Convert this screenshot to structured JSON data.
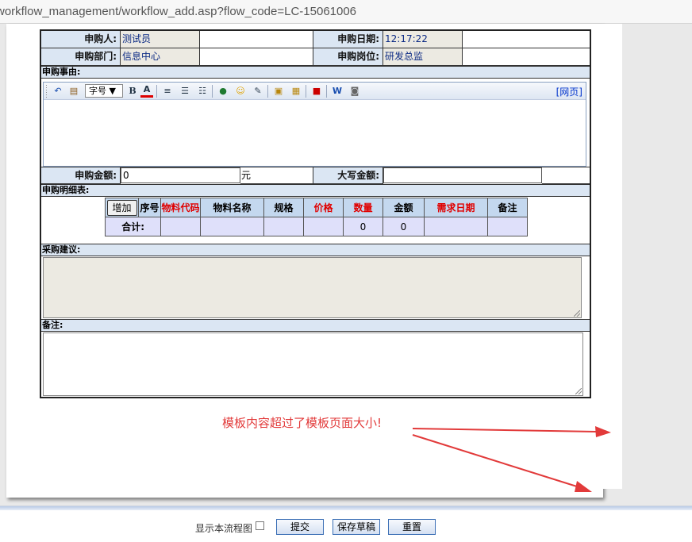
{
  "browser": {
    "url": "workflow_management/workflow_add.asp?flow_code=LC-15061006"
  },
  "form": {
    "applicant_label": "申购人:",
    "applicant_value": "测试员",
    "date_label": "申购日期:",
    "date_value": "12:17:22",
    "dept_label": "申购部门:",
    "dept_value": "信息中心",
    "post_label": "申购岗位:",
    "post_value": "研发总监",
    "reason_label": "申购事由:",
    "amount_label": "申购金额:",
    "amount_value": "0",
    "amount_unit": "元",
    "amount_upper_label": "大写金额:",
    "detail_label": "申购明细表:",
    "advice_label": "采购建议:",
    "remark_label": "备注:"
  },
  "editor": {
    "font_size_select": "字号 ▼",
    "bold": "B",
    "font_color": "A",
    "web_link": "[网页]"
  },
  "detail_table": {
    "add_button": "增加",
    "headers": [
      "序号",
      "物料代码",
      "物料名称",
      "规格",
      "价格",
      "数量",
      "金额",
      "需求日期",
      "备注"
    ],
    "header_colors": [
      "#000000",
      "#e00000",
      "#000000",
      "#000000",
      "#e00000",
      "#e00000",
      "#000000",
      "#e00000",
      "#000000"
    ],
    "total_label": "合计:",
    "total_qty": "0",
    "total_amount": "0"
  },
  "annotation": {
    "warning": "模板内容超过了模板页面大小!"
  },
  "bottom": {
    "show_flow_label": "显示本流程图",
    "submit": "提交",
    "save_draft": "保存草稿",
    "reset": "重置"
  }
}
